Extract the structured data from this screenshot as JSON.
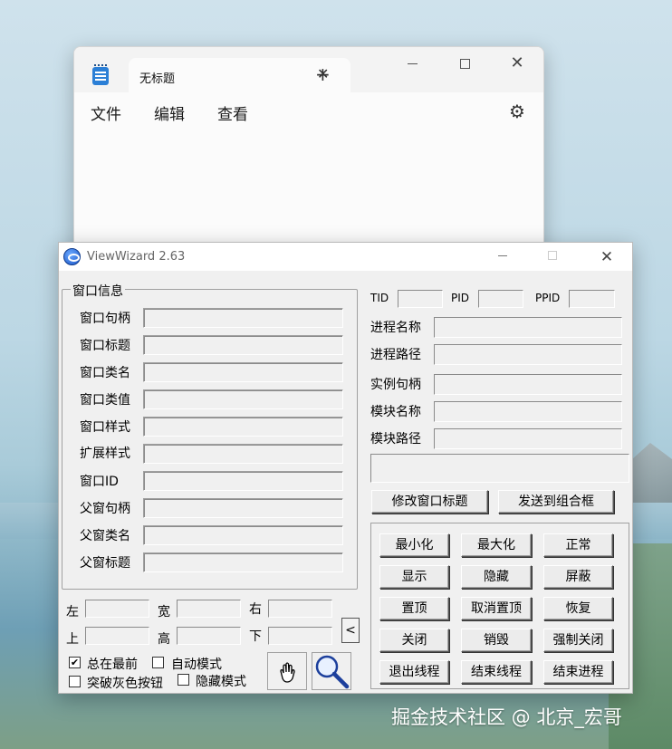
{
  "notepad": {
    "tab_title": "无标题",
    "tab_close": "✕",
    "new_tab": "+",
    "close": "✕",
    "menus": [
      "文件",
      "编辑",
      "查看"
    ],
    "settings_icon": "gear-icon"
  },
  "viewwizard": {
    "title": "ViewWizard 2.63",
    "close": "✕",
    "window_info": {
      "group_label": "窗口信息",
      "fields": [
        "窗口句柄",
        "窗口标题",
        "窗口类名",
        "窗口类值",
        "窗口样式",
        "扩展样式",
        "窗口ID",
        "父窗句柄",
        "父窗类名",
        "父窗标题"
      ]
    },
    "rect": {
      "left": "左",
      "width": "宽",
      "right": "右",
      "top": "上",
      "height": "高",
      "bottom": "下"
    },
    "collapse_arrow": "<",
    "options": {
      "always_on_top": {
        "label": "总在最前",
        "checked": true
      },
      "auto_mode": {
        "label": "自动模式",
        "checked": false
      },
      "break_gray": {
        "label": "突破灰色按钮",
        "checked": false
      },
      "hidden_mode": {
        "label": "隐藏模式",
        "checked": false
      }
    },
    "process": {
      "tid": "TID",
      "pid": "PID",
      "ppid": "PPID",
      "fields": [
        "进程名称",
        "进程路径",
        "实例句柄",
        "模块名称",
        "模块路径"
      ]
    },
    "actions": {
      "modify_title": "修改窗口标题",
      "send_to_combo": "发送到组合框"
    },
    "buttons": [
      [
        "最小化",
        "最大化",
        "正常"
      ],
      [
        "显示",
        "隐藏",
        "屏蔽"
      ],
      [
        "置顶",
        "取消置顶",
        "恢复"
      ],
      [
        "关闭",
        "销毁",
        "强制关闭"
      ],
      [
        "退出线程",
        "结束线程",
        "结束进程"
      ]
    ]
  },
  "watermark": "掘金技术社区 @ 北京_宏哥",
  "colors": {
    "notepad_icon": "#2b7fd6",
    "dialog_bg": "#f0f0f0"
  }
}
